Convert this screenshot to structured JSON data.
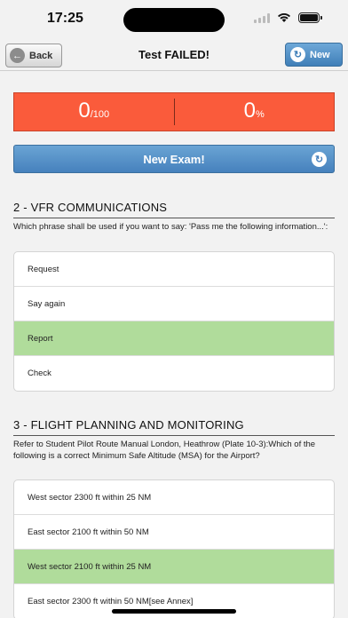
{
  "status_bar": {
    "time": "17:25"
  },
  "nav": {
    "back_label": "Back",
    "title": "Test FAILED!",
    "new_label": "New"
  },
  "score": {
    "points": "0",
    "points_max": "/100",
    "percent": "0",
    "percent_unit": "%"
  },
  "exam_button": {
    "label": "New Exam!"
  },
  "colors": {
    "fail_red": "#fa5b3b",
    "button_blue": "#4681bd",
    "correct_green": "#b0dc9b"
  },
  "questions": [
    {
      "title": "2 - VFR COMMUNICATIONS",
      "text": "Which phrase shall be used if you want to say: 'Pass me the following information...':",
      "answers": [
        {
          "label": "Request",
          "correct": false
        },
        {
          "label": "Say again",
          "correct": false
        },
        {
          "label": "Report",
          "correct": true
        },
        {
          "label": "Check",
          "correct": false
        }
      ]
    },
    {
      "title": "3 - FLIGHT PLANNING AND MONITORING",
      "text": "Refer to Student Pilot Route Manual London, Heathrow (Plate 10-3):Which of the following is a correct Minimum Safe Altitude (MSA) for the Airport?",
      "answers": [
        {
          "label": "West sector 2300 ft within 25 NM",
          "correct": false
        },
        {
          "label": "East sector 2100 ft within 50 NM",
          "correct": false
        },
        {
          "label": "West sector 2100 ft within 25 NM",
          "correct": true
        },
        {
          "label": "East sector 2300 ft within 50 NM[see Annex]",
          "correct": false
        }
      ]
    }
  ]
}
